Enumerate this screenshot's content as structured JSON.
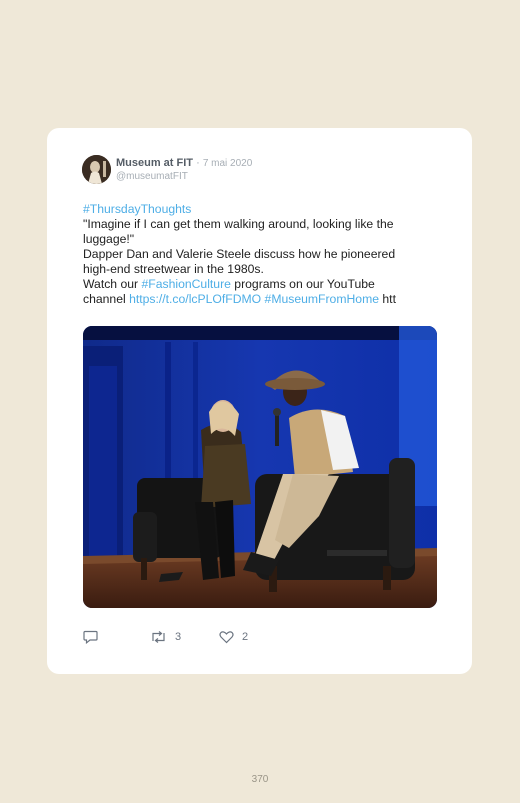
{
  "tweet": {
    "author_name": "Museum at FIT",
    "separator": "·",
    "date": "7 mai 2020",
    "handle": "@museumatFIT",
    "hashtag_thursday": "#ThursdayThoughts",
    "quote_line1": "\"Imagine if I can get them walking around, looking like the",
    "quote_line2": "luggage!\"",
    "desc_line1": "Dapper Dan and Valerie Steele discuss how he pioneered",
    "desc_line2": "high-end streetwear in the 1980s.",
    "watch_prefix": "Watch our ",
    "hashtag_fashion": "#FashionCulture",
    "watch_suffix": " programs on our YouTube",
    "channel_prefix": "channel ",
    "short_link": "https://t.co/lcPLOfFDMO",
    "hashtag_home": "#MuseumFromHome",
    "truncated": " htt"
  },
  "actions": {
    "reply_icon": "reply-icon",
    "retweet_icon": "retweet-icon",
    "retweet_count": "3",
    "like_icon": "heart-icon",
    "like_count": "2"
  },
  "colors": {
    "link": "#4eaee6",
    "background": "#efe8d8",
    "card": "#ffffff"
  },
  "page": {
    "number": "370"
  }
}
